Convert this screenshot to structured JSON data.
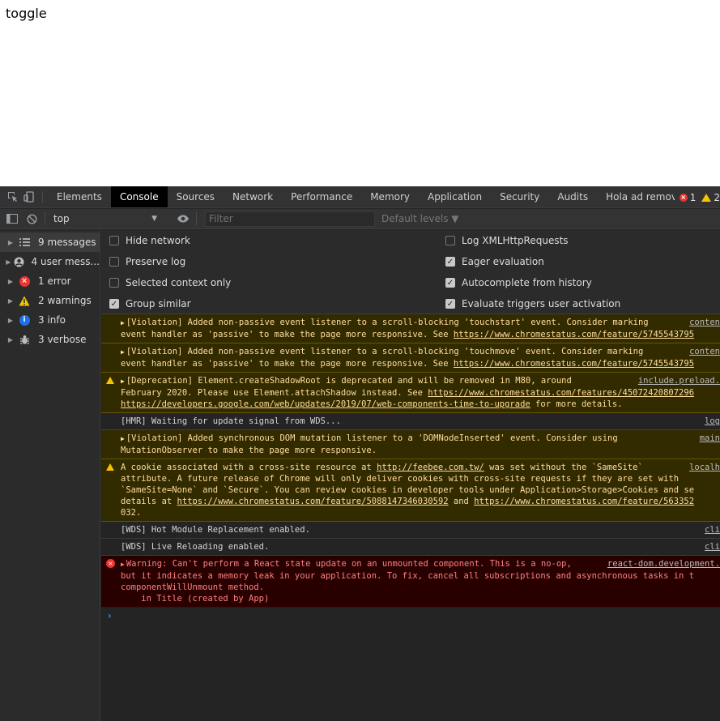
{
  "page": {
    "text": "toggle"
  },
  "tabs": [
    "Elements",
    "Console",
    "Sources",
    "Network",
    "Performance",
    "Memory",
    "Application",
    "Security",
    "Audits",
    "Hola ad remover"
  ],
  "active_tab": "Console",
  "counters": {
    "errors": "1",
    "warnings": "2"
  },
  "toolbar": {
    "context": "top",
    "filter_placeholder": "Filter",
    "levels": "Default levels ▼"
  },
  "sidebar": {
    "items": [
      {
        "label": "9 messages",
        "icon": "list-icon"
      },
      {
        "label": "4 user mess...",
        "icon": "user-icon"
      },
      {
        "label": "1 error",
        "icon": "error-icon"
      },
      {
        "label": "2 warnings",
        "icon": "warning-icon"
      },
      {
        "label": "3 info",
        "icon": "info-icon"
      },
      {
        "label": "3 verbose",
        "icon": "bug-icon"
      }
    ]
  },
  "settings": {
    "left": [
      {
        "label": "Hide network",
        "checked": false
      },
      {
        "label": "Preserve log",
        "checked": false
      },
      {
        "label": "Selected context only",
        "checked": false
      },
      {
        "label": "Group similar",
        "checked": true
      }
    ],
    "right": [
      {
        "label": "Log XMLHttpRequests",
        "checked": false
      },
      {
        "label": "Eager evaluation",
        "checked": true
      },
      {
        "label": "Autocomplete from history",
        "checked": true
      },
      {
        "label": "Evaluate triggers user activation",
        "checked": true
      }
    ]
  },
  "messages": [
    {
      "level": "warn",
      "icon": "",
      "expand": true,
      "source": "conten",
      "lines": [
        "[Violation] Added non-passive event listener to a scroll-blocking 'touchstart' event. Consider marking",
        "event handler as 'passive' to make the page more responsive. See https://www.chromestatus.com/feature/5745543795"
      ]
    },
    {
      "level": "warn",
      "icon": "",
      "expand": true,
      "source": "conten",
      "lines": [
        "[Violation] Added non-passive event listener to a scroll-blocking 'touchmove' event. Consider marking",
        "event handler as 'passive' to make the page more responsive. See https://www.chromestatus.com/feature/5745543795"
      ]
    },
    {
      "level": "warn",
      "icon": "warning",
      "expand": true,
      "source": "include.preload.",
      "lines": [
        "[Deprecation] Element.createShadowRoot is deprecated and will be removed in M80, around",
        "February 2020. Please use Element.attachShadow instead. See https://www.chromestatus.com/features/45072420807296",
        "https://developers.google.com/web/updates/2019/07/web-components-time-to-upgrade for more details."
      ]
    },
    {
      "level": "plain",
      "icon": "",
      "expand": false,
      "source": "log",
      "lines": [
        "[HMR] Waiting for update signal from WDS..."
      ]
    },
    {
      "level": "warn",
      "icon": "",
      "expand": true,
      "source": "main",
      "lines": [
        "[Violation] Added synchronous DOM mutation listener to a 'DOMNodeInserted' event. Consider using",
        "MutationObserver to make the page more responsive."
      ]
    },
    {
      "level": "warn",
      "icon": "warning",
      "expand": false,
      "source": "localh",
      "lines": [
        "A cookie associated with a cross-site resource at http://feebee.com.tw/ was set without the `SameSite`",
        "attribute. A future release of Chrome will only deliver cookies with cross-site requests if they are set with",
        "`SameSite=None` and `Secure`. You can review cookies in developer tools under Application>Storage>Cookies and se",
        "details at https://www.chromestatus.com/feature/5088147346030592 and https://www.chromestatus.com/feature/563352",
        "032."
      ]
    },
    {
      "level": "plain",
      "icon": "",
      "expand": false,
      "source": "cli",
      "lines": [
        "[WDS] Hot Module Replacement enabled."
      ]
    },
    {
      "level": "plain",
      "icon": "",
      "expand": false,
      "source": "cli",
      "lines": [
        "[WDS] Live Reloading enabled."
      ]
    },
    {
      "level": "err",
      "icon": "error",
      "expand": true,
      "source": "react-dom.development.",
      "lines": [
        "Warning: Can't perform a React state update on an unmounted component. This is a no-op,",
        "but it indicates a memory leak in your application. To fix, cancel all subscriptions and asynchronous tasks in t",
        "componentWillUnmount method.",
        "    in Title (created by App)"
      ]
    }
  ],
  "prompt": "›",
  "colors": {
    "error": "#ee3333",
    "warning": "#f5c400",
    "info": "#1a73e8",
    "accent": "#4d9cff"
  }
}
